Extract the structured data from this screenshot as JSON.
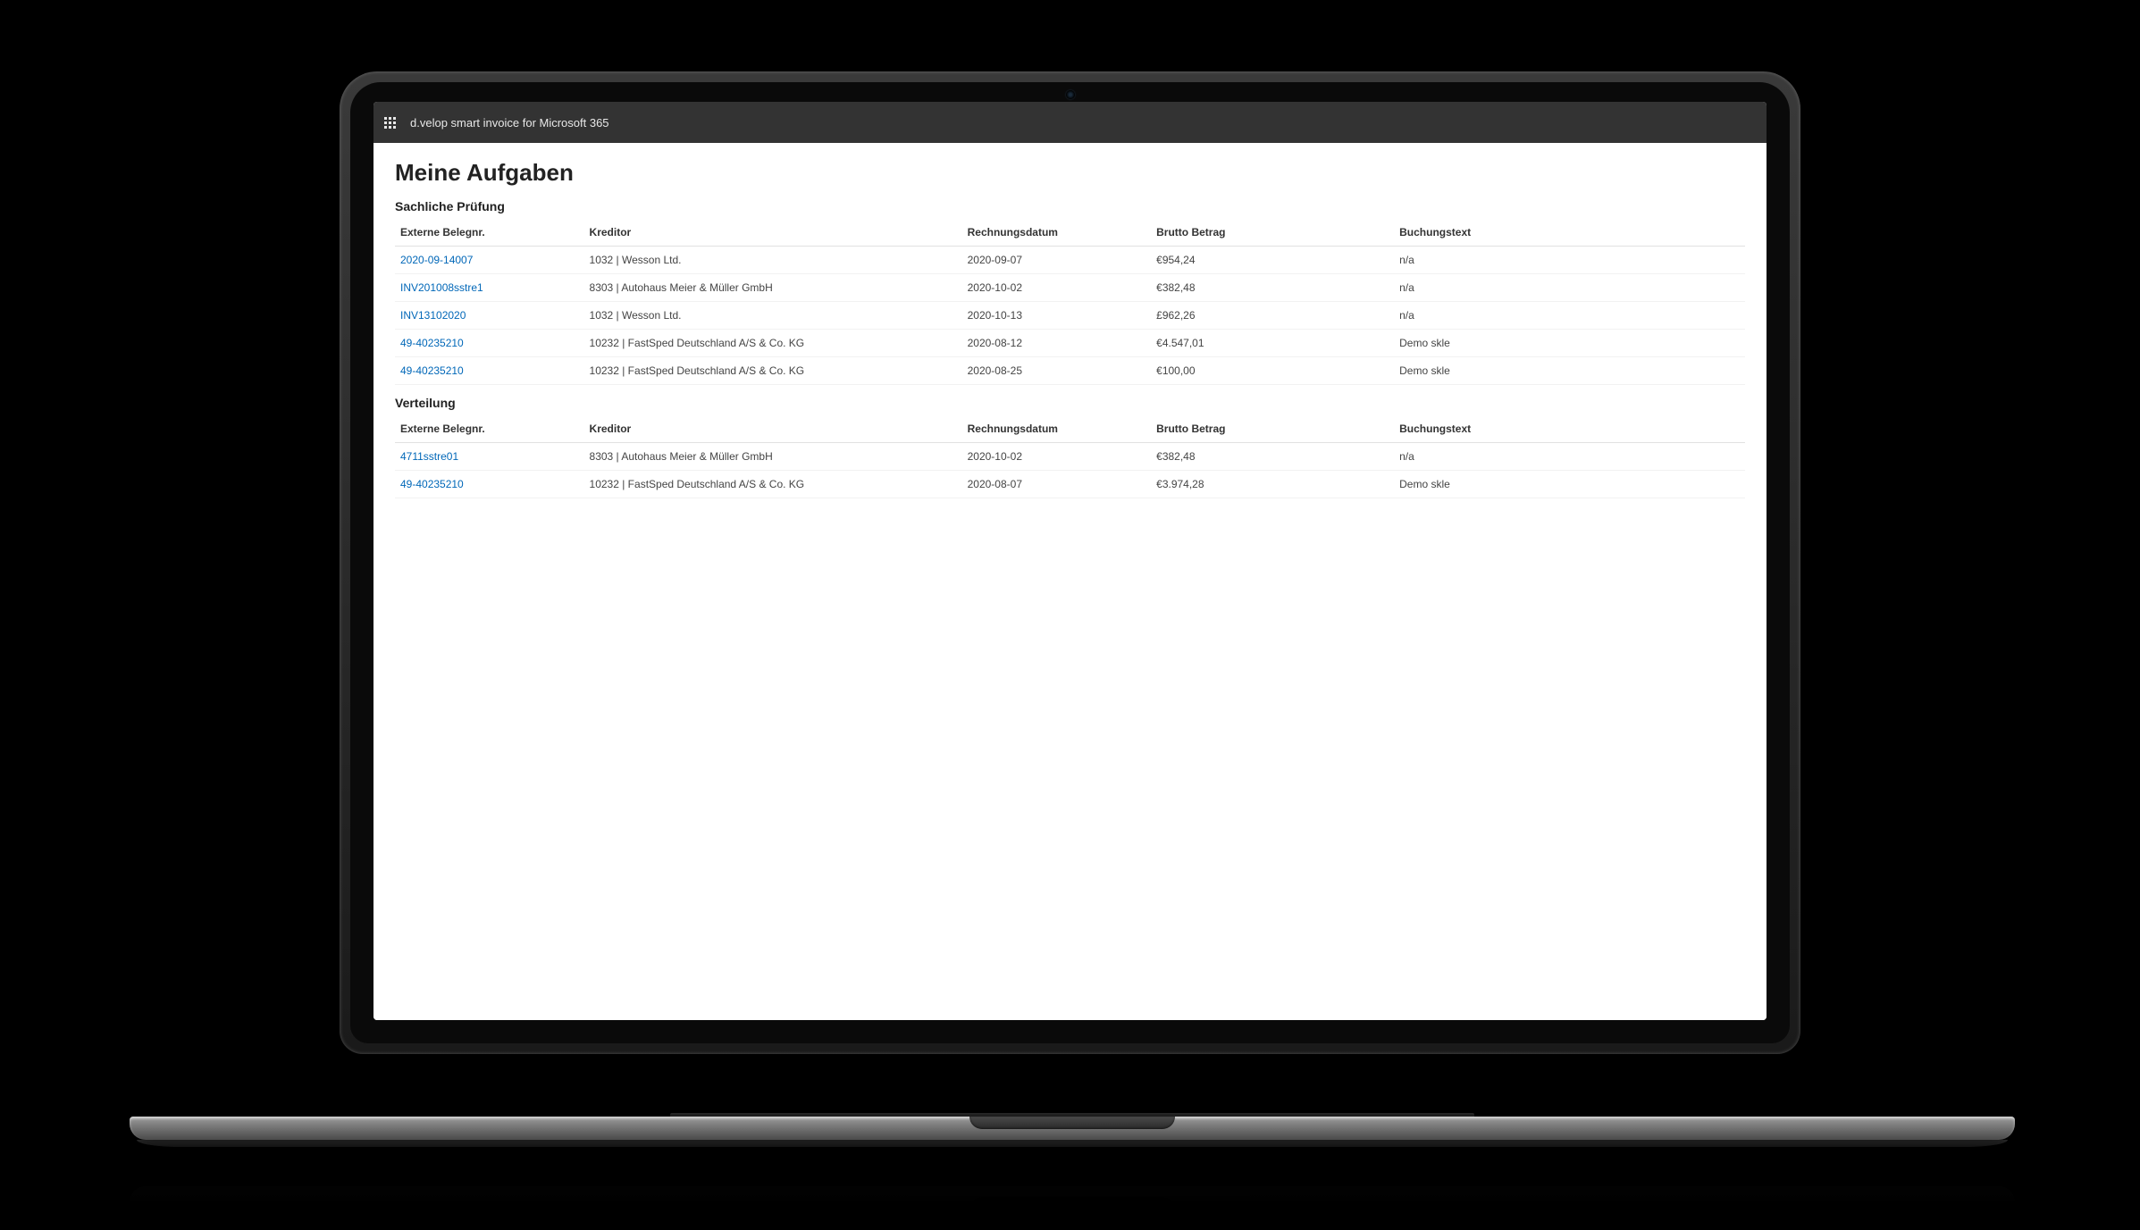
{
  "header": {
    "app_title": "d.velop smart invoice for Microsoft 365"
  },
  "page": {
    "title": "Meine Aufgaben"
  },
  "columns": {
    "beleg": "Externe Belegnr.",
    "kreditor": "Kreditor",
    "datum": "Rechnungsdatum",
    "betrag": "Brutto Betrag",
    "text": "Buchungstext"
  },
  "sections": [
    {
      "title": "Sachliche Prüfung",
      "rows": [
        {
          "beleg": "2020-09-14007",
          "kreditor": "1032 | Wesson Ltd.",
          "datum": "2020-09-07",
          "betrag": "€954,24",
          "text": "n/a"
        },
        {
          "beleg": "INV201008sstre1",
          "kreditor": "8303 | Autohaus Meier & Müller GmbH",
          "datum": "2020-10-02",
          "betrag": "€382,48",
          "text": "n/a"
        },
        {
          "beleg": "INV13102020",
          "kreditor": "1032 | Wesson Ltd.",
          "datum": "2020-10-13",
          "betrag": "£962,26",
          "text": "n/a"
        },
        {
          "beleg": "49-40235210",
          "kreditor": "10232 | FastSped Deutschland A/S & Co. KG",
          "datum": "2020-08-12",
          "betrag": "€4.547,01",
          "text": "Demo skle"
        },
        {
          "beleg": "49-40235210",
          "kreditor": "10232 | FastSped Deutschland A/S & Co. KG",
          "datum": "2020-08-25",
          "betrag": "€100,00",
          "text": "Demo skle"
        }
      ]
    },
    {
      "title": "Verteilung",
      "rows": [
        {
          "beleg": "4711sstre01",
          "kreditor": "8303 | Autohaus Meier & Müller GmbH",
          "datum": "2020-10-02",
          "betrag": "€382,48",
          "text": "n/a"
        },
        {
          "beleg": "49-40235210",
          "kreditor": "10232 | FastSped Deutschland A/S & Co. KG",
          "datum": "2020-08-07",
          "betrag": "€3.974,28",
          "text": "Demo skle"
        }
      ]
    }
  ]
}
